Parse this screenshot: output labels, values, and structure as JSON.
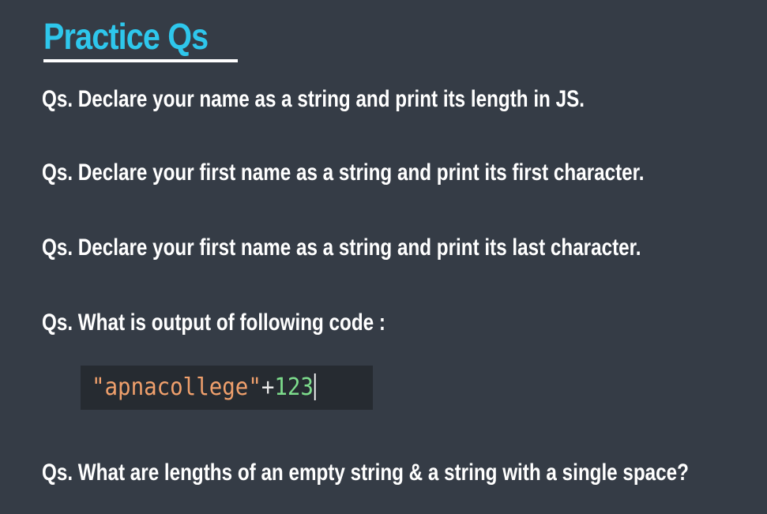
{
  "slide": {
    "title": "Practice Qs",
    "questions": [
      "Qs. Declare your name as a string and print its length in JS.",
      "Qs. Declare your first name as a string and print its first character.",
      "Qs. Declare your first name as a string and print its last character.",
      "Qs. What is output of following code :",
      "Qs. What are lengths of an empty string & a string with a single space?"
    ],
    "code": {
      "string_literal": "\"apnacollege\"",
      "operator": "+",
      "number": "123"
    }
  },
  "colors": {
    "background": "#353c46",
    "title": "#2ec7ec",
    "text": "#ffffff",
    "code_background": "#262b31",
    "code_string": "#f0a06c",
    "code_number": "#7ddc8c"
  }
}
